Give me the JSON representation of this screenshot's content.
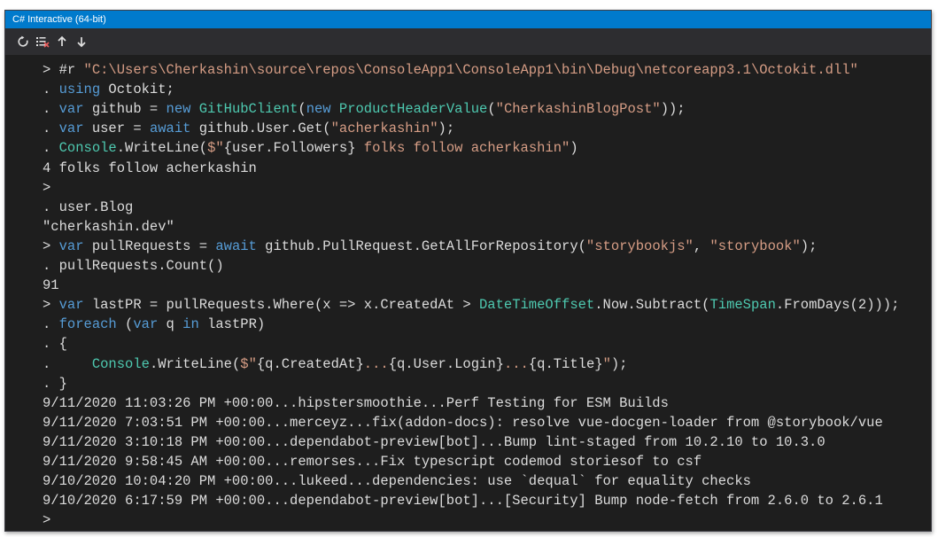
{
  "window": {
    "title": "C# Interactive (64-bit)"
  },
  "toolbar": {
    "buttons": [
      {
        "name": "reset-icon"
      },
      {
        "name": "clear-icon"
      },
      {
        "name": "history-up-icon"
      },
      {
        "name": "history-down-icon"
      }
    ]
  },
  "colors": {
    "keyword": "#569cd6",
    "string": "#d69d85",
    "type": "#4ec9b0",
    "text": "#dcdcdc",
    "background": "#1e1e1e",
    "titlebar": "#007acc"
  },
  "console": {
    "lines": [
      {
        "kind": "input",
        "tokens": [
          [
            "p",
            "> #r "
          ],
          [
            "s",
            "\"C:\\Users\\Cherkashin\\source\\repos\\ConsoleApp1\\ConsoleApp1\\bin\\Debug\\netcoreapp3.1\\Octokit.dll\""
          ]
        ]
      },
      {
        "kind": "input",
        "tokens": [
          [
            "p",
            ". "
          ],
          [
            "k",
            "using"
          ],
          [
            "p",
            " Octokit;"
          ]
        ]
      },
      {
        "kind": "input",
        "tokens": [
          [
            "p",
            ". "
          ],
          [
            "k",
            "var"
          ],
          [
            "p",
            " github = "
          ],
          [
            "k",
            "new"
          ],
          [
            "p",
            " "
          ],
          [
            "t",
            "GitHubClient"
          ],
          [
            "p",
            "("
          ],
          [
            "k",
            "new"
          ],
          [
            "p",
            " "
          ],
          [
            "t",
            "ProductHeaderValue"
          ],
          [
            "p",
            "("
          ],
          [
            "s",
            "\"CherkashinBlogPost\""
          ],
          [
            "p",
            "));"
          ]
        ]
      },
      {
        "kind": "input",
        "tokens": [
          [
            "p",
            ". "
          ],
          [
            "k",
            "var"
          ],
          [
            "p",
            " user = "
          ],
          [
            "k",
            "await"
          ],
          [
            "p",
            " github.User.Get("
          ],
          [
            "s",
            "\"acherkashin\""
          ],
          [
            "p",
            ");"
          ]
        ]
      },
      {
        "kind": "input",
        "tokens": [
          [
            "p",
            ". "
          ],
          [
            "t",
            "Console"
          ],
          [
            "p",
            ".WriteLine("
          ],
          [
            "s",
            "$\""
          ],
          [
            "p",
            "{user.Followers}"
          ],
          [
            "s",
            " folks follow acherkashin\""
          ],
          [
            "p",
            ")"
          ]
        ]
      },
      {
        "kind": "output",
        "tokens": [
          [
            "p",
            "4 folks follow acherkashin"
          ]
        ]
      },
      {
        "kind": "input",
        "tokens": [
          [
            "p",
            ">"
          ]
        ]
      },
      {
        "kind": "input",
        "tokens": [
          [
            "p",
            ". user.Blog"
          ]
        ]
      },
      {
        "kind": "output",
        "tokens": [
          [
            "p",
            "\"cherkashin.dev\""
          ]
        ]
      },
      {
        "kind": "input",
        "tokens": [
          [
            "p",
            "> "
          ],
          [
            "k",
            "var"
          ],
          [
            "p",
            " pullRequests = "
          ],
          [
            "k",
            "await"
          ],
          [
            "p",
            " github.PullRequest.GetAllForRepository("
          ],
          [
            "s",
            "\"storybookjs\""
          ],
          [
            "p",
            ", "
          ],
          [
            "s",
            "\"storybook\""
          ],
          [
            "p",
            ");"
          ]
        ]
      },
      {
        "kind": "input",
        "tokens": [
          [
            "p",
            ". pullRequests.Count()"
          ]
        ]
      },
      {
        "kind": "output",
        "tokens": [
          [
            "p",
            "91"
          ]
        ]
      },
      {
        "kind": "input",
        "tokens": [
          [
            "p",
            "> "
          ],
          [
            "k",
            "var"
          ],
          [
            "p",
            " lastPR = pullRequests.Where(x => x.CreatedAt > "
          ],
          [
            "t",
            "DateTimeOffset"
          ],
          [
            "p",
            ".Now.Subtract("
          ],
          [
            "t",
            "TimeSpan"
          ],
          [
            "p",
            ".FromDays(2)));"
          ]
        ]
      },
      {
        "kind": "input",
        "tokens": [
          [
            "p",
            ". "
          ],
          [
            "k",
            "foreach"
          ],
          [
            "p",
            " ("
          ],
          [
            "k",
            "var"
          ],
          [
            "p",
            " q "
          ],
          [
            "k",
            "in"
          ],
          [
            "p",
            " lastPR)"
          ]
        ]
      },
      {
        "kind": "input",
        "tokens": [
          [
            "p",
            ". {"
          ]
        ]
      },
      {
        "kind": "input",
        "tokens": [
          [
            "p",
            ".     "
          ],
          [
            "t",
            "Console"
          ],
          [
            "p",
            ".WriteLine("
          ],
          [
            "s",
            "$\""
          ],
          [
            "p",
            "{q.CreatedAt}"
          ],
          [
            "s",
            "..."
          ],
          [
            "p",
            "{q.User.Login}"
          ],
          [
            "s",
            "..."
          ],
          [
            "p",
            "{q.Title}"
          ],
          [
            "s",
            "\""
          ],
          [
            "p",
            ");"
          ]
        ]
      },
      {
        "kind": "input",
        "tokens": [
          [
            "p",
            ". }"
          ]
        ]
      },
      {
        "kind": "output",
        "tokens": [
          [
            "p",
            "9/11/2020 11:03:26 PM +00:00...hipstersmoothie...Perf Testing for ESM Builds"
          ]
        ]
      },
      {
        "kind": "output",
        "tokens": [
          [
            "p",
            "9/11/2020 7:03:51 PM +00:00...merceyz...fix(addon-docs): resolve vue-docgen-loader from @storybook/vue"
          ]
        ]
      },
      {
        "kind": "output",
        "tokens": [
          [
            "p",
            "9/11/2020 3:10:18 PM +00:00...dependabot-preview[bot]...Bump lint-staged from 10.2.10 to 10.3.0"
          ]
        ]
      },
      {
        "kind": "output",
        "tokens": [
          [
            "p",
            "9/11/2020 9:58:45 AM +00:00...remorses...Fix typescript codemod storiesof to csf"
          ]
        ]
      },
      {
        "kind": "output",
        "tokens": [
          [
            "p",
            "9/10/2020 10:04:20 PM +00:00...lukeed...dependencies: use `dequal` for equality checks"
          ]
        ]
      },
      {
        "kind": "output",
        "tokens": [
          [
            "p",
            "9/10/2020 6:17:59 PM +00:00...dependabot-preview[bot]...[Security] Bump node-fetch from 2.6.0 to 2.6.1"
          ]
        ]
      },
      {
        "kind": "prompt",
        "tokens": [
          [
            "p",
            ">"
          ]
        ]
      }
    ]
  }
}
